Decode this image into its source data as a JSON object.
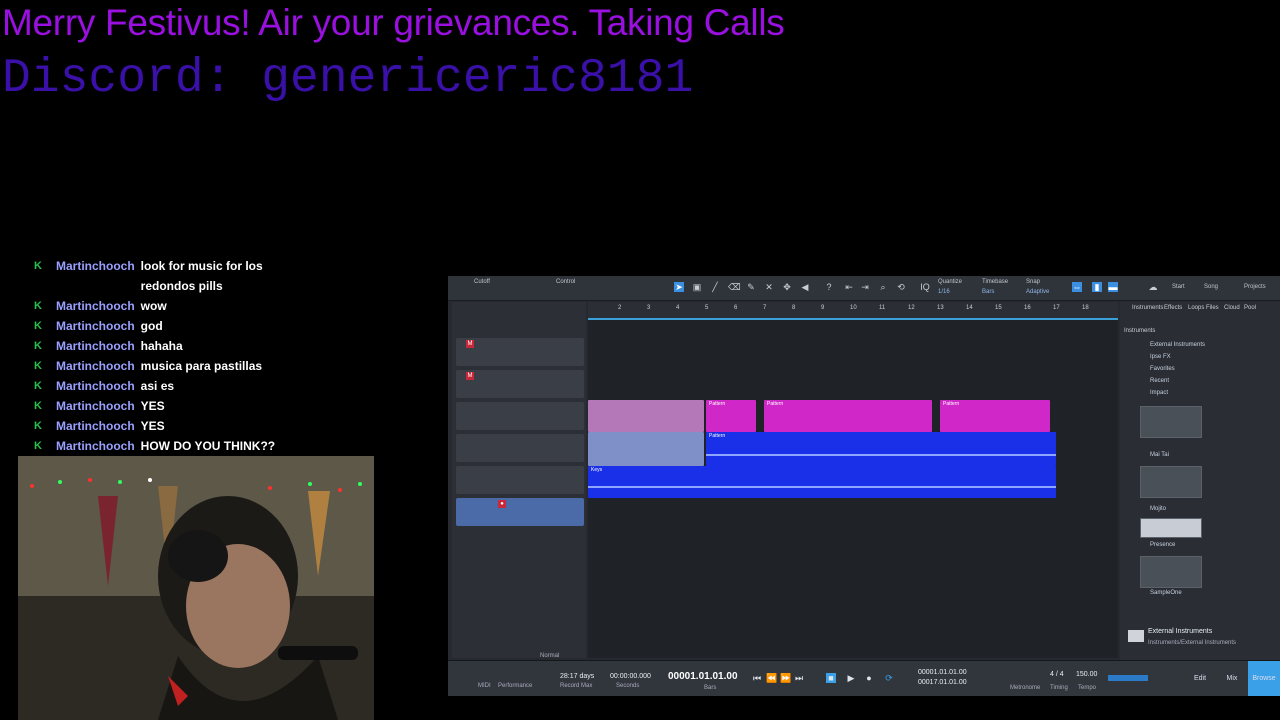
{
  "banner": {
    "line1": "Merry Festivus! Air your grievances. Taking Calls",
    "line2": "Discord: genericeric8181"
  },
  "chat": [
    {
      "user": "Martinchooch",
      "msg": "look for music for los redondos pills"
    },
    {
      "user": "Martinchooch",
      "msg": "wow"
    },
    {
      "user": "Martinchooch",
      "msg": "god"
    },
    {
      "user": "Martinchooch",
      "msg": "hahaha"
    },
    {
      "user": "Martinchooch",
      "msg": "musica para pastillas"
    },
    {
      "user": "Martinchooch",
      "msg": "asi es"
    },
    {
      "user": "Martinchooch",
      "msg": "YES"
    },
    {
      "user": "Martinchooch",
      "msg": "YES"
    },
    {
      "user": "Martinchooch",
      "msg": "HOW DO YOU THINK??"
    }
  ],
  "daw": {
    "toolbar": {
      "cutoff": "Cutoff",
      "control": "Control",
      "quantize_label": "Quantize",
      "quantize_value": "1/16",
      "timebase_label": "Timebase",
      "timebase_value": "Bars",
      "snap_label": "Snap",
      "snap_value": "Adaptive",
      "start": "Start",
      "song": "Song",
      "project": "Projects"
    },
    "ruler": [
      "2",
      "3",
      "4",
      "5",
      "6",
      "7",
      "8",
      "9",
      "10",
      "11",
      "12",
      "13",
      "14",
      "15",
      "16",
      "17",
      "18"
    ],
    "clip_label_pattern": "Pattern",
    "clip_label_keys": "Keys",
    "browser": {
      "tabs": [
        "Instruments",
        "Effects",
        "Loops",
        "Files",
        "Cloud",
        "Pool"
      ],
      "heading": "Instruments",
      "items": [
        "External Instruments",
        "Ipse FX",
        "Favorites",
        "Recent",
        "Impact",
        "Mai Tai",
        "Mojito",
        "Presence",
        "SampleOne"
      ],
      "footer_title": "External Instruments",
      "footer_sub": "Instruments/External Instruments"
    },
    "transport": {
      "midi_label": "MIDI",
      "performance_label": "Performance",
      "days": "28:17 days",
      "record_max": "Record Max",
      "seconds_value": "00:00:00.000",
      "seconds_label": "Seconds",
      "timecode": "00001.01.01.00",
      "bars_label": "Bars",
      "l_value": "00001.01.01.00",
      "r_value": "00017.01.01.00",
      "sig": "4 / 4",
      "sig_label": "Timing",
      "tempo": "150.00",
      "tempo_label": "Tempo",
      "metronome_label": "Metronome",
      "normal": "Normal",
      "edit": "Edit",
      "mix": "Mix",
      "browse": "Browse"
    }
  }
}
